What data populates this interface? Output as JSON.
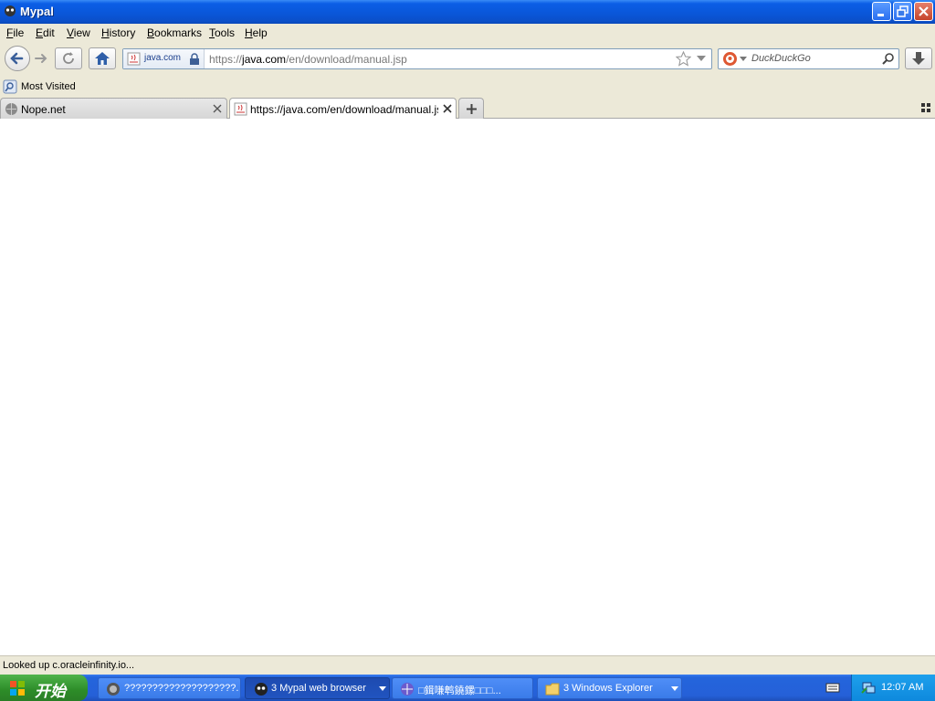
{
  "window": {
    "title": "Mypal"
  },
  "menu": [
    {
      "label": "File",
      "key": "F",
      "rest": "ile"
    },
    {
      "label": "Edit",
      "key": "E",
      "rest": "dit"
    },
    {
      "label": "View",
      "key": "V",
      "rest": "iew"
    },
    {
      "label": "History",
      "key": "H",
      "rest": "istory"
    },
    {
      "label": "Bookmarks",
      "key": "B",
      "rest": "ookmarks"
    },
    {
      "label": "Tools",
      "key": "T",
      "rest": "ools"
    },
    {
      "label": "Help",
      "key": "H",
      "rest": "elp"
    }
  ],
  "urlbar": {
    "identity": "java.com",
    "scheme": "https://",
    "host": "java.com",
    "path": "/en/download/manual.jsp"
  },
  "search": {
    "placeholder": "DuckDuckGo"
  },
  "bookmarks": {
    "most_visited": "Most Visited"
  },
  "tabs": [
    {
      "label": "Nope.net",
      "active": false
    },
    {
      "label": "https://java.com/en/download/manual.jsp",
      "active": true
    }
  ],
  "status": {
    "text": "Looked up c.oracleinfinity.io..."
  },
  "taskbar": {
    "start_label": "开始",
    "items": [
      {
        "label": "????????????????????..."
      },
      {
        "label": "3 Mypal web browser"
      },
      {
        "label": "□鍓嗛鹎鐃鏍□□□..."
      },
      {
        "label": "3 Windows Explorer"
      }
    ],
    "clock": "12:07 AM"
  },
  "colors": {
    "titlebar": "#0b5ee6",
    "chrome": "#ece9d8",
    "taskbar": "#2560d8",
    "start": "#2d8c28"
  }
}
